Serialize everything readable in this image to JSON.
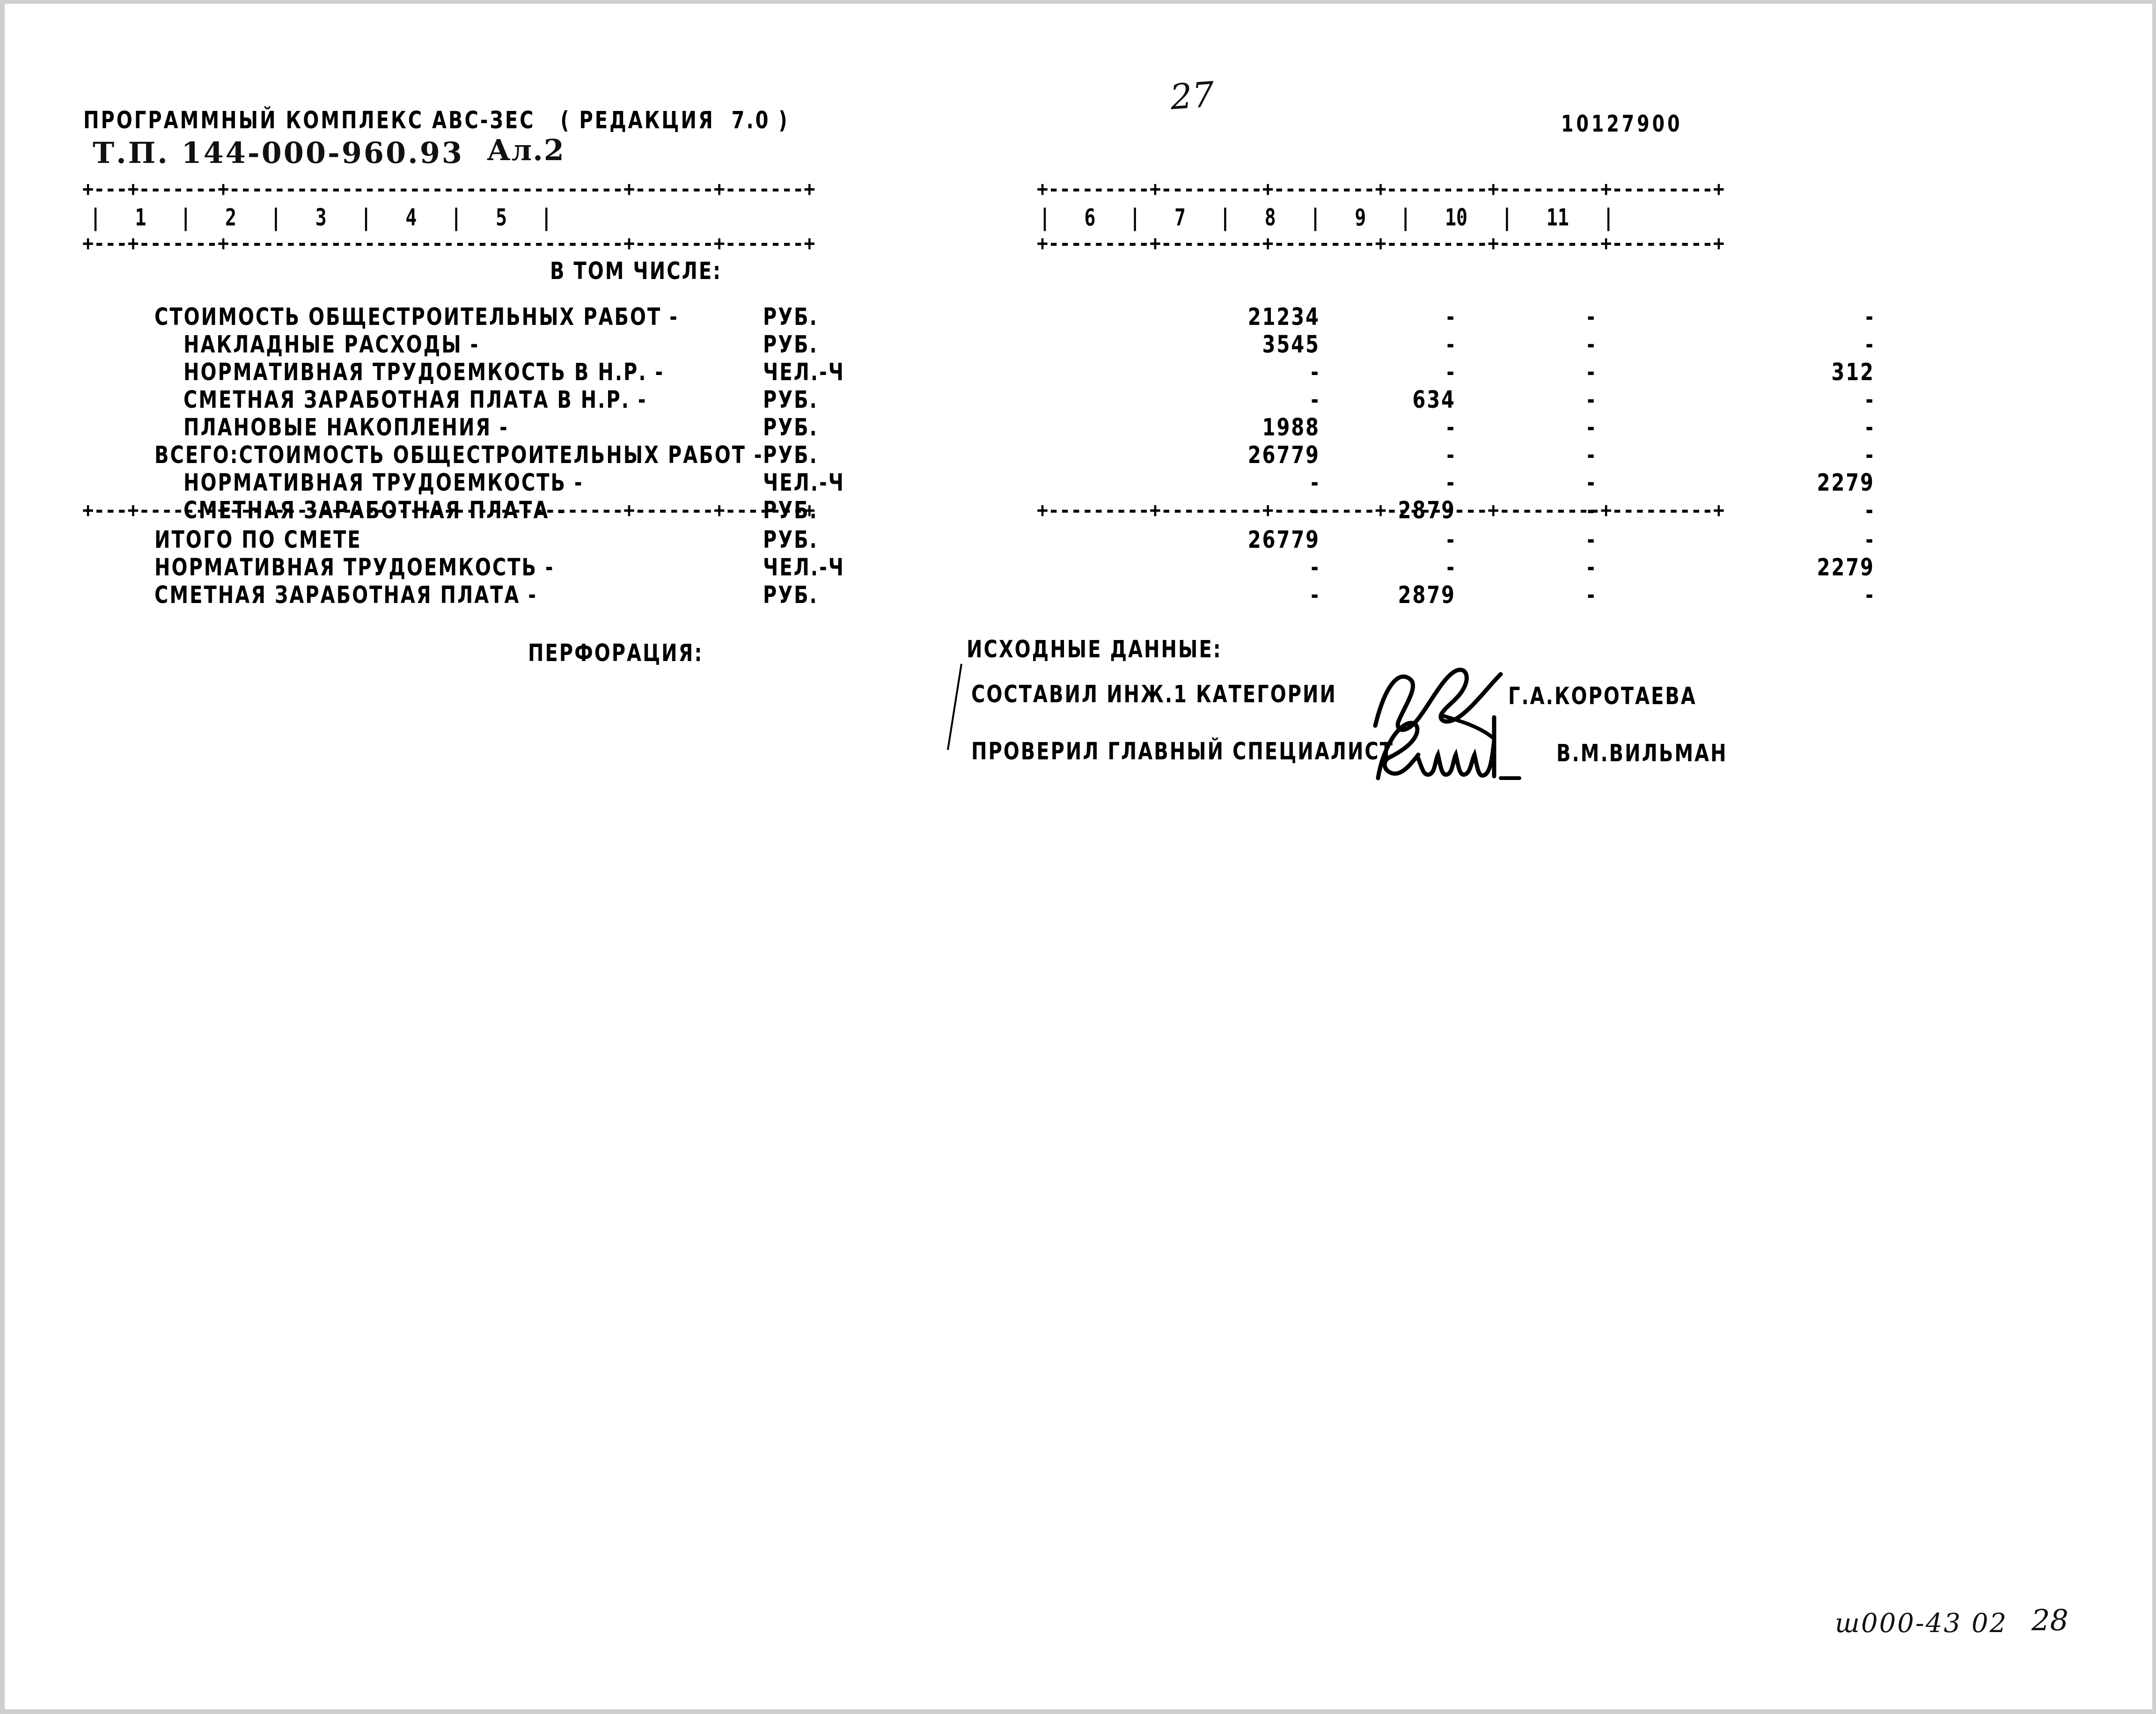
{
  "document": {
    "program_header": "ПРОГРАММНЫЙ КОМПЛЕКС АВС-ЗЕС   ( РЕДАКЦИЯ  7.0 )",
    "object_code": "Т.П. 144-000-960.93",
    "sheet_label": "Ал.2",
    "page_number_handwritten": "27",
    "document_number": "10127900",
    "bottom_handwritten_note": "ш000-43 02",
    "bottom_handwritten_page": "28"
  },
  "table": {
    "column_numbers_left": [
      "1",
      "2",
      "3",
      "4",
      "5"
    ],
    "column_numbers_right": [
      "6",
      "7",
      "8",
      "9",
      "10",
      "11"
    ],
    "separator_left": "+---+-------+-----------------------------------+-------+-------+",
    "separator_right": "+---------+---------+---------+---------+---------+---------+",
    "subheading": "В ТОМ ЧИСЛЕ:",
    "rows": [
      {
        "label": "СТОИМОСТЬ ОБЩЕСТРОИТЕЛЬНЫХ РАБОТ -",
        "unit": "РУБ.",
        "indent": 0,
        "c6": "21234",
        "c8": "-",
        "c9": "-",
        "c11": "-"
      },
      {
        "label": "НАКЛАДНЫЕ РАСХОДЫ -",
        "unit": "РУБ.",
        "indent": 1,
        "c6": "3545",
        "c8": "-",
        "c9": "-",
        "c11": "-"
      },
      {
        "label": "НОРМАТИВНАЯ ТРУДОЕМКОСТЬ В Н.Р. -",
        "unit": "ЧЕЛ.-Ч",
        "indent": 1,
        "c6": "-",
        "c8": "-",
        "c9": "-",
        "c11": "312"
      },
      {
        "label": "СМЕТНАЯ ЗАРАБОТНАЯ ПЛАТА В Н.Р. -",
        "unit": "РУБ.",
        "indent": 1,
        "c6": "-",
        "c8": "634",
        "c9": "-",
        "c11": "-"
      },
      {
        "label": "ПЛАНОВЫЕ НАКОПЛЕНИЯ -",
        "unit": "РУБ.",
        "indent": 1,
        "c6": "1988",
        "c8": "-",
        "c9": "-",
        "c11": "-"
      },
      {
        "label": "ВСЕГО:СТОИМОСТЬ ОБЩЕСТРОИТЕЛЬНЫХ РАБОТ -",
        "unit": "РУБ.",
        "indent": 0,
        "c6": "26779",
        "c8": "-",
        "c9": "-",
        "c11": "-"
      },
      {
        "label": "НОРМАТИВНАЯ ТРУДОЕМКОСТЬ -",
        "unit": "ЧЕЛ.-Ч",
        "indent": 1,
        "c6": "-",
        "c8": "-",
        "c9": "-",
        "c11": "2279"
      },
      {
        "label": "СМЕТНАЯ ЗАРАБОТНАЯ ПЛАТА -",
        "unit": "РУБ.",
        "indent": 1,
        "c6": "-",
        "c8": "2879",
        "c9": "-",
        "c11": "-"
      }
    ],
    "totals": [
      {
        "label": "ИТОГО ПО СМЕТЕ",
        "unit": "РУБ.",
        "c6": "26779",
        "c8": "-",
        "c9": "-",
        "c11": "-"
      },
      {
        "label": "НОРМАТИВНАЯ ТРУДОЕМКОСТЬ -",
        "unit": "ЧЕЛ.-Ч",
        "c6": "-",
        "c8": "-",
        "c9": "-",
        "c11": "2279"
      },
      {
        "label": "СМЕТНАЯ ЗАРАБОТНАЯ ПЛАТА -",
        "unit": "РУБ.",
        "c6": "-",
        "c8": "2879",
        "c9": "-",
        "c11": "-"
      }
    ]
  },
  "footer": {
    "perforation_label": "ПЕРФОРАЦИЯ:",
    "source_data_label": "ИСХОДНЫЕ ДАННЫЕ:",
    "compiled_by_role": "СОСТАВИЛ ИНЖ.1 КАТЕГОРИИ",
    "compiled_by_name": "Г.А.КОРОТАЕВА",
    "checked_by_role": "ПРОВЕРИЛ ГЛАВНЫЙ СПЕЦИАЛИСТ",
    "checked_by_name": "В.М.ВИЛЬМАН"
  }
}
